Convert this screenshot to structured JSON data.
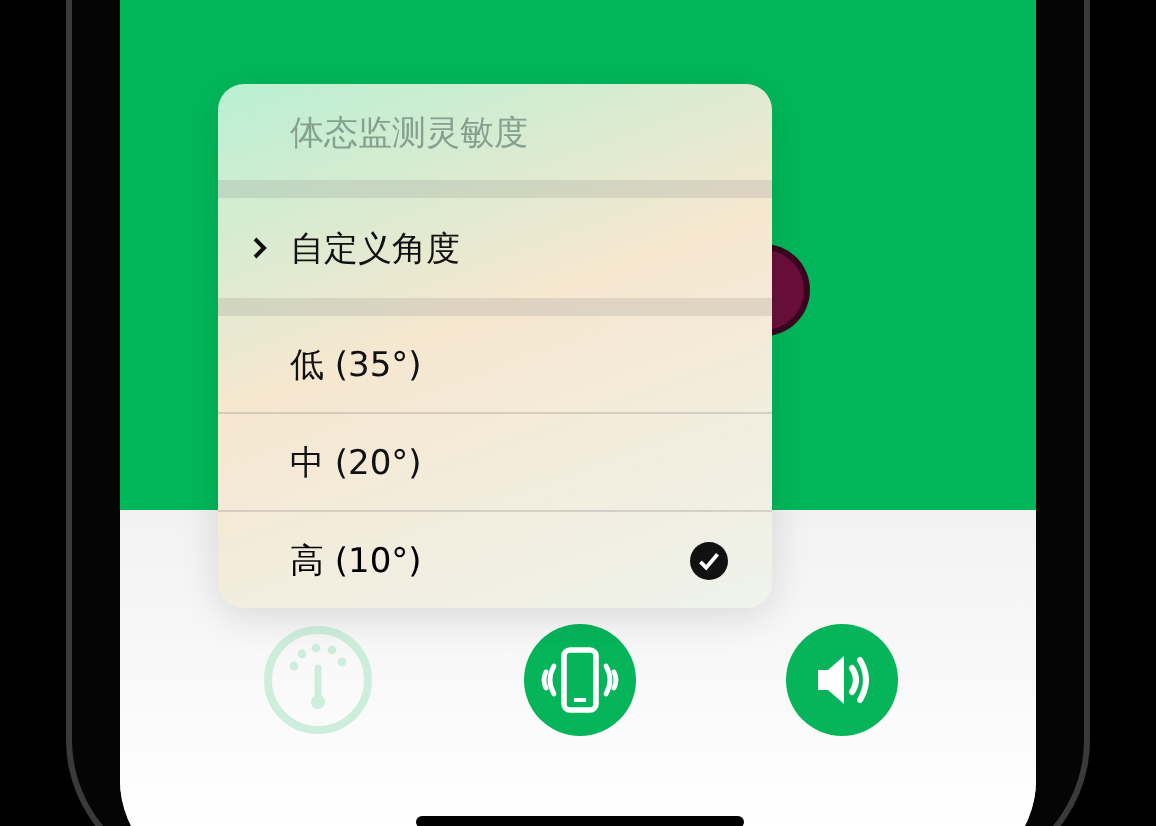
{
  "menu": {
    "title": "体态监测灵敏度",
    "submenu": {
      "label": "自定义角度"
    },
    "options": [
      {
        "label": "低 (35°)",
        "selected": false
      },
      {
        "label": "中 (20°)",
        "selected": false
      },
      {
        "label": "高 (10°)",
        "selected": true
      }
    ]
  },
  "controls": [
    {
      "kind": "gauge",
      "on": false
    },
    {
      "kind": "vibrate",
      "on": true
    },
    {
      "kind": "sound",
      "on": true
    }
  ]
}
